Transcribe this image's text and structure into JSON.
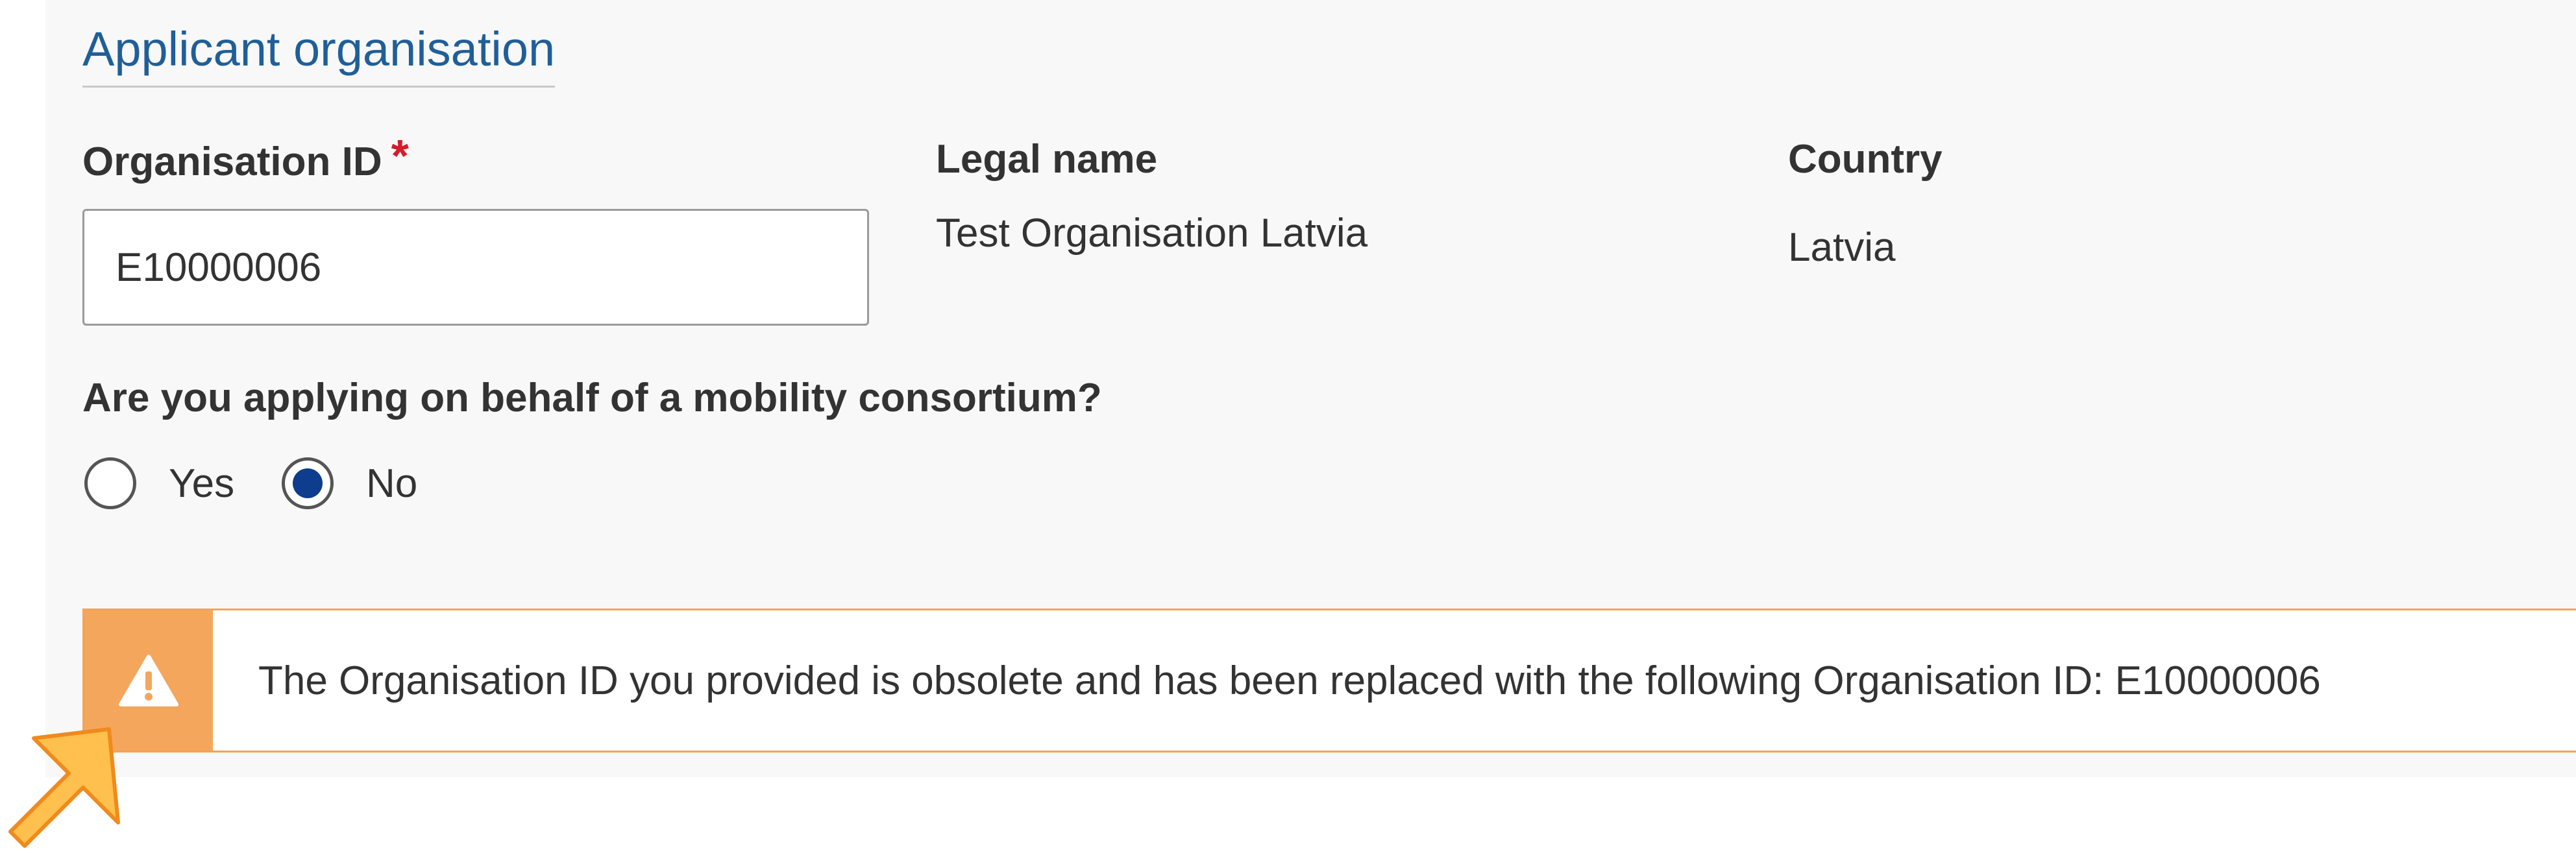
{
  "section": {
    "title": "Applicant organisation"
  },
  "fields": {
    "organisation_id": {
      "label": "Organisation ID",
      "required_marker": "*",
      "value": "E10000006"
    },
    "legal_name": {
      "label": "Legal name",
      "value": "Test Organisation Latvia"
    },
    "country": {
      "label": "Country",
      "value": "Latvia"
    }
  },
  "consortium_question": {
    "label": "Are you applying on behalf of a mobility consortium?",
    "options": [
      {
        "label": "Yes",
        "selected": false
      },
      {
        "label": "No",
        "selected": true
      }
    ]
  },
  "alert": {
    "type": "warning",
    "icon": "warning-triangle-icon",
    "message": "The Organisation ID you provided is obsolete and has been replaced with the following Organisation ID: E10000006"
  },
  "colors": {
    "section_title": "#1f5f99",
    "required": "#d61b2b",
    "radio_selected": "#0d3d8c",
    "alert_accent": "#f4a65c",
    "pointer": "#ffc04d"
  }
}
